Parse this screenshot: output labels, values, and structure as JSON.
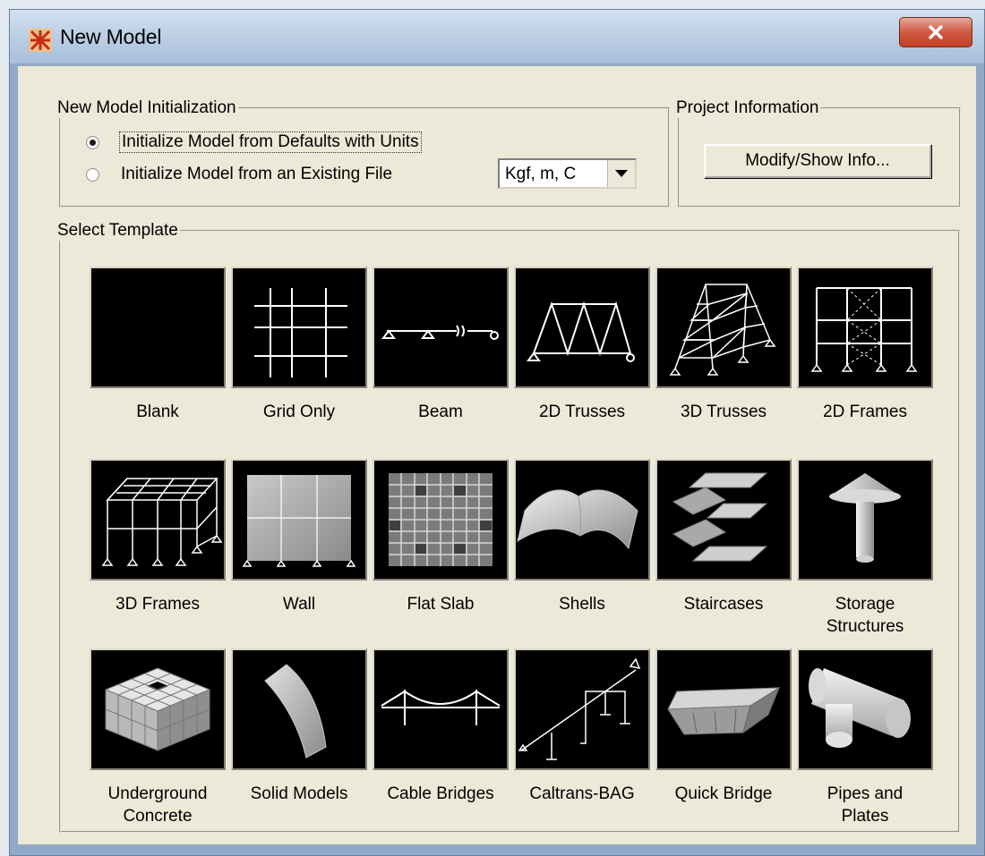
{
  "window": {
    "title": "New Model",
    "icon": "app-logo-icon",
    "close_icon": "close-icon"
  },
  "init": {
    "legend": "New Model Initialization",
    "option_defaults": "Initialize Model from Defaults with Units",
    "option_existing": "Initialize Model  from an Existing File",
    "selected_option": "defaults",
    "units_value": "Kgf, m, C",
    "units_arrow_icon": "chevron-down-icon"
  },
  "project": {
    "legend": "Project Information",
    "button_label": "Modify/Show Info..."
  },
  "templates": {
    "legend": "Select Template",
    "items": [
      {
        "label": "Blank",
        "icon": "blank-template-icon"
      },
      {
        "label": "Grid Only",
        "icon": "grid-template-icon"
      },
      {
        "label": "Beam",
        "icon": "beam-template-icon"
      },
      {
        "label": "2D Trusses",
        "icon": "2d-truss-template-icon"
      },
      {
        "label": "3D Trusses",
        "icon": "3d-truss-template-icon"
      },
      {
        "label": "2D Frames",
        "icon": "2d-frame-template-icon"
      },
      {
        "label": "3D Frames",
        "icon": "3d-frame-template-icon"
      },
      {
        "label": "Wall",
        "icon": "wall-template-icon"
      },
      {
        "label": "Flat Slab",
        "icon": "flat-slab-template-icon"
      },
      {
        "label": "Shells",
        "icon": "shells-template-icon"
      },
      {
        "label": "Staircases",
        "icon": "staircase-template-icon"
      },
      {
        "label": "Storage\nStructures",
        "icon": "storage-structure-template-icon"
      },
      {
        "label": "Underground\nConcrete",
        "icon": "underground-concrete-template-icon"
      },
      {
        "label": "Solid Models",
        "icon": "solid-model-template-icon"
      },
      {
        "label": "Cable Bridges",
        "icon": "cable-bridge-template-icon"
      },
      {
        "label": "Caltrans-BAG",
        "icon": "caltrans-bag-template-icon"
      },
      {
        "label": "Quick Bridge",
        "icon": "quick-bridge-template-icon"
      },
      {
        "label": "Pipes and\nPlates",
        "icon": "pipes-plates-template-icon"
      }
    ]
  }
}
